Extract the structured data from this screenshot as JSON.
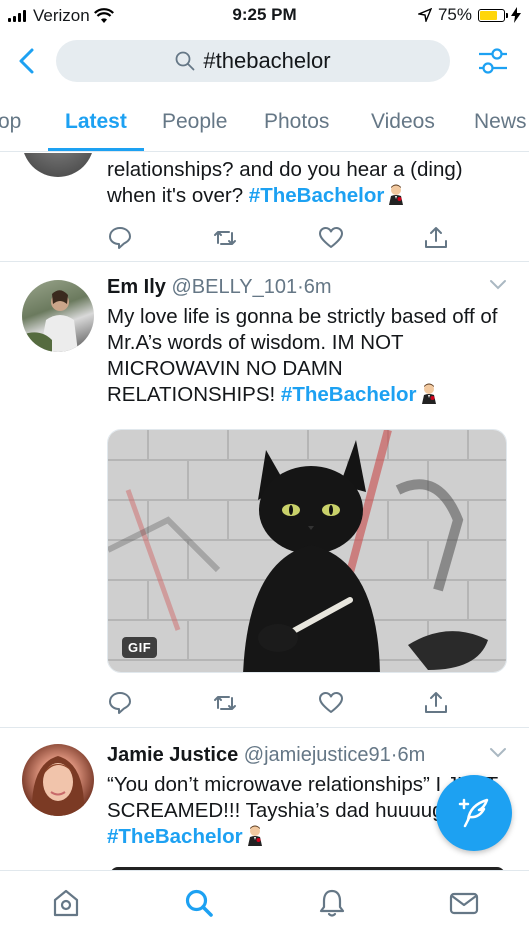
{
  "status_bar": {
    "carrier": "Verizon",
    "time": "9:25 PM",
    "battery_percent": "75%",
    "battery_level": 0.75
  },
  "search": {
    "query": "#thebachelor"
  },
  "tabs": [
    {
      "label": "op",
      "active": false
    },
    {
      "label": "Latest",
      "active": true
    },
    {
      "label": "People",
      "active": false
    },
    {
      "label": "Photos",
      "active": false
    },
    {
      "label": "Videos",
      "active": false
    },
    {
      "label": "News",
      "active": false
    }
  ],
  "tweets": [
    {
      "text": "relationships? and do you hear a (ding) when it's over?",
      "hashtag": "#TheBachelor"
    },
    {
      "name": "Em Ily",
      "handle": "@BELLY_101",
      "sep": "·",
      "time": "6m",
      "text": "My love life is gonna be strictly based off of Mr.A’s words of wisdom. IM NOT MICROWAVIN NO DAMN RELATIONSHIPS!",
      "hashtag": "#TheBachelor",
      "media_badge": "GIF"
    },
    {
      "name": "Jamie Justice",
      "handle": "@jamiejustice91",
      "sep": "·",
      "time": "6m",
      "text": "“You don’t microwave relationships” I JUST SCREAMED!!! Tayshia’s dad huuuuge win",
      "hashtag": "#TheBachelor"
    }
  ],
  "colors": {
    "accent": "#1da1f2",
    "text": "#14171a",
    "muted": "#657786"
  },
  "icons": [
    "back-icon",
    "search-icon",
    "filter-icon",
    "reply-icon",
    "retweet-icon",
    "like-icon",
    "share-icon",
    "home-icon",
    "explore-icon",
    "notifications-icon",
    "messages-icon",
    "compose-icon"
  ]
}
